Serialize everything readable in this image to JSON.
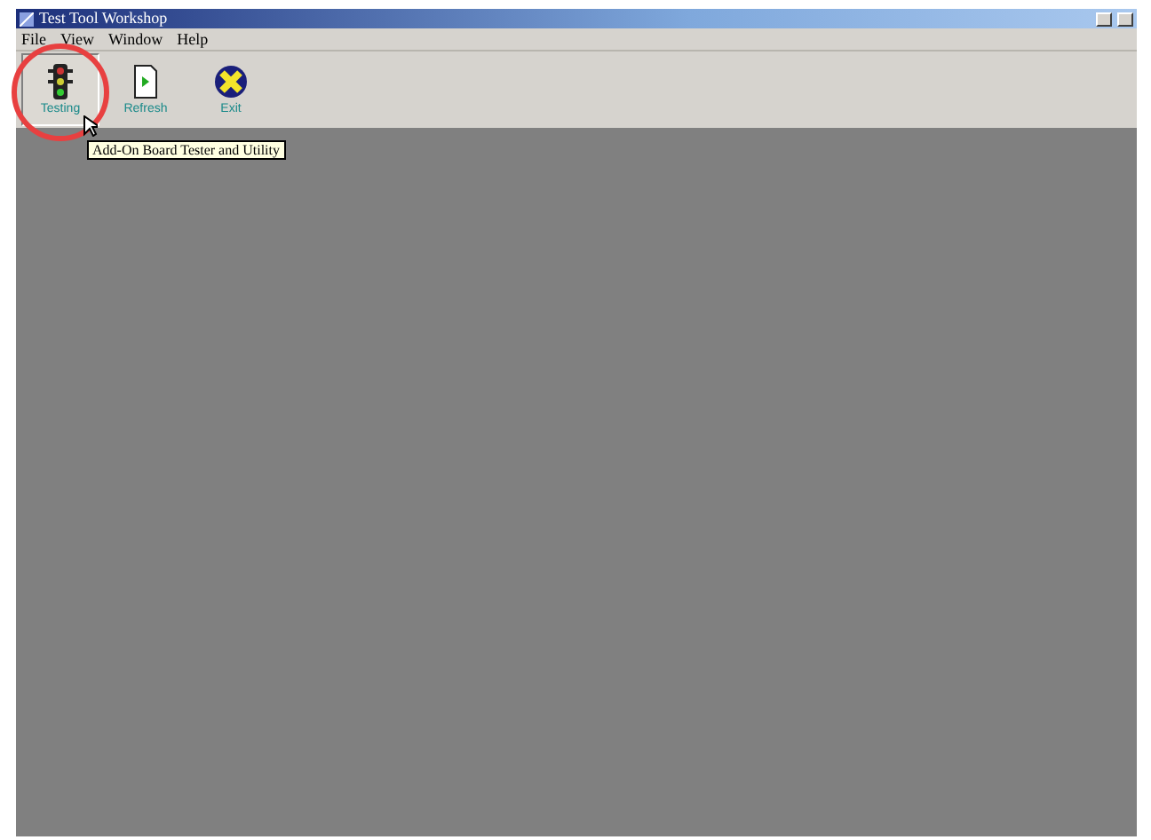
{
  "window": {
    "title": "Test Tool Workshop"
  },
  "menu": [
    "File",
    "View",
    "Window",
    "Help"
  ],
  "toolbar": [
    {
      "label": "Testing",
      "kind": "traffic-light",
      "pressed": true
    },
    {
      "label": "Refresh",
      "kind": "document",
      "pressed": false
    },
    {
      "label": "Exit",
      "kind": "exit",
      "pressed": false
    }
  ],
  "tooltip": "Add-On Board Tester and Utility"
}
